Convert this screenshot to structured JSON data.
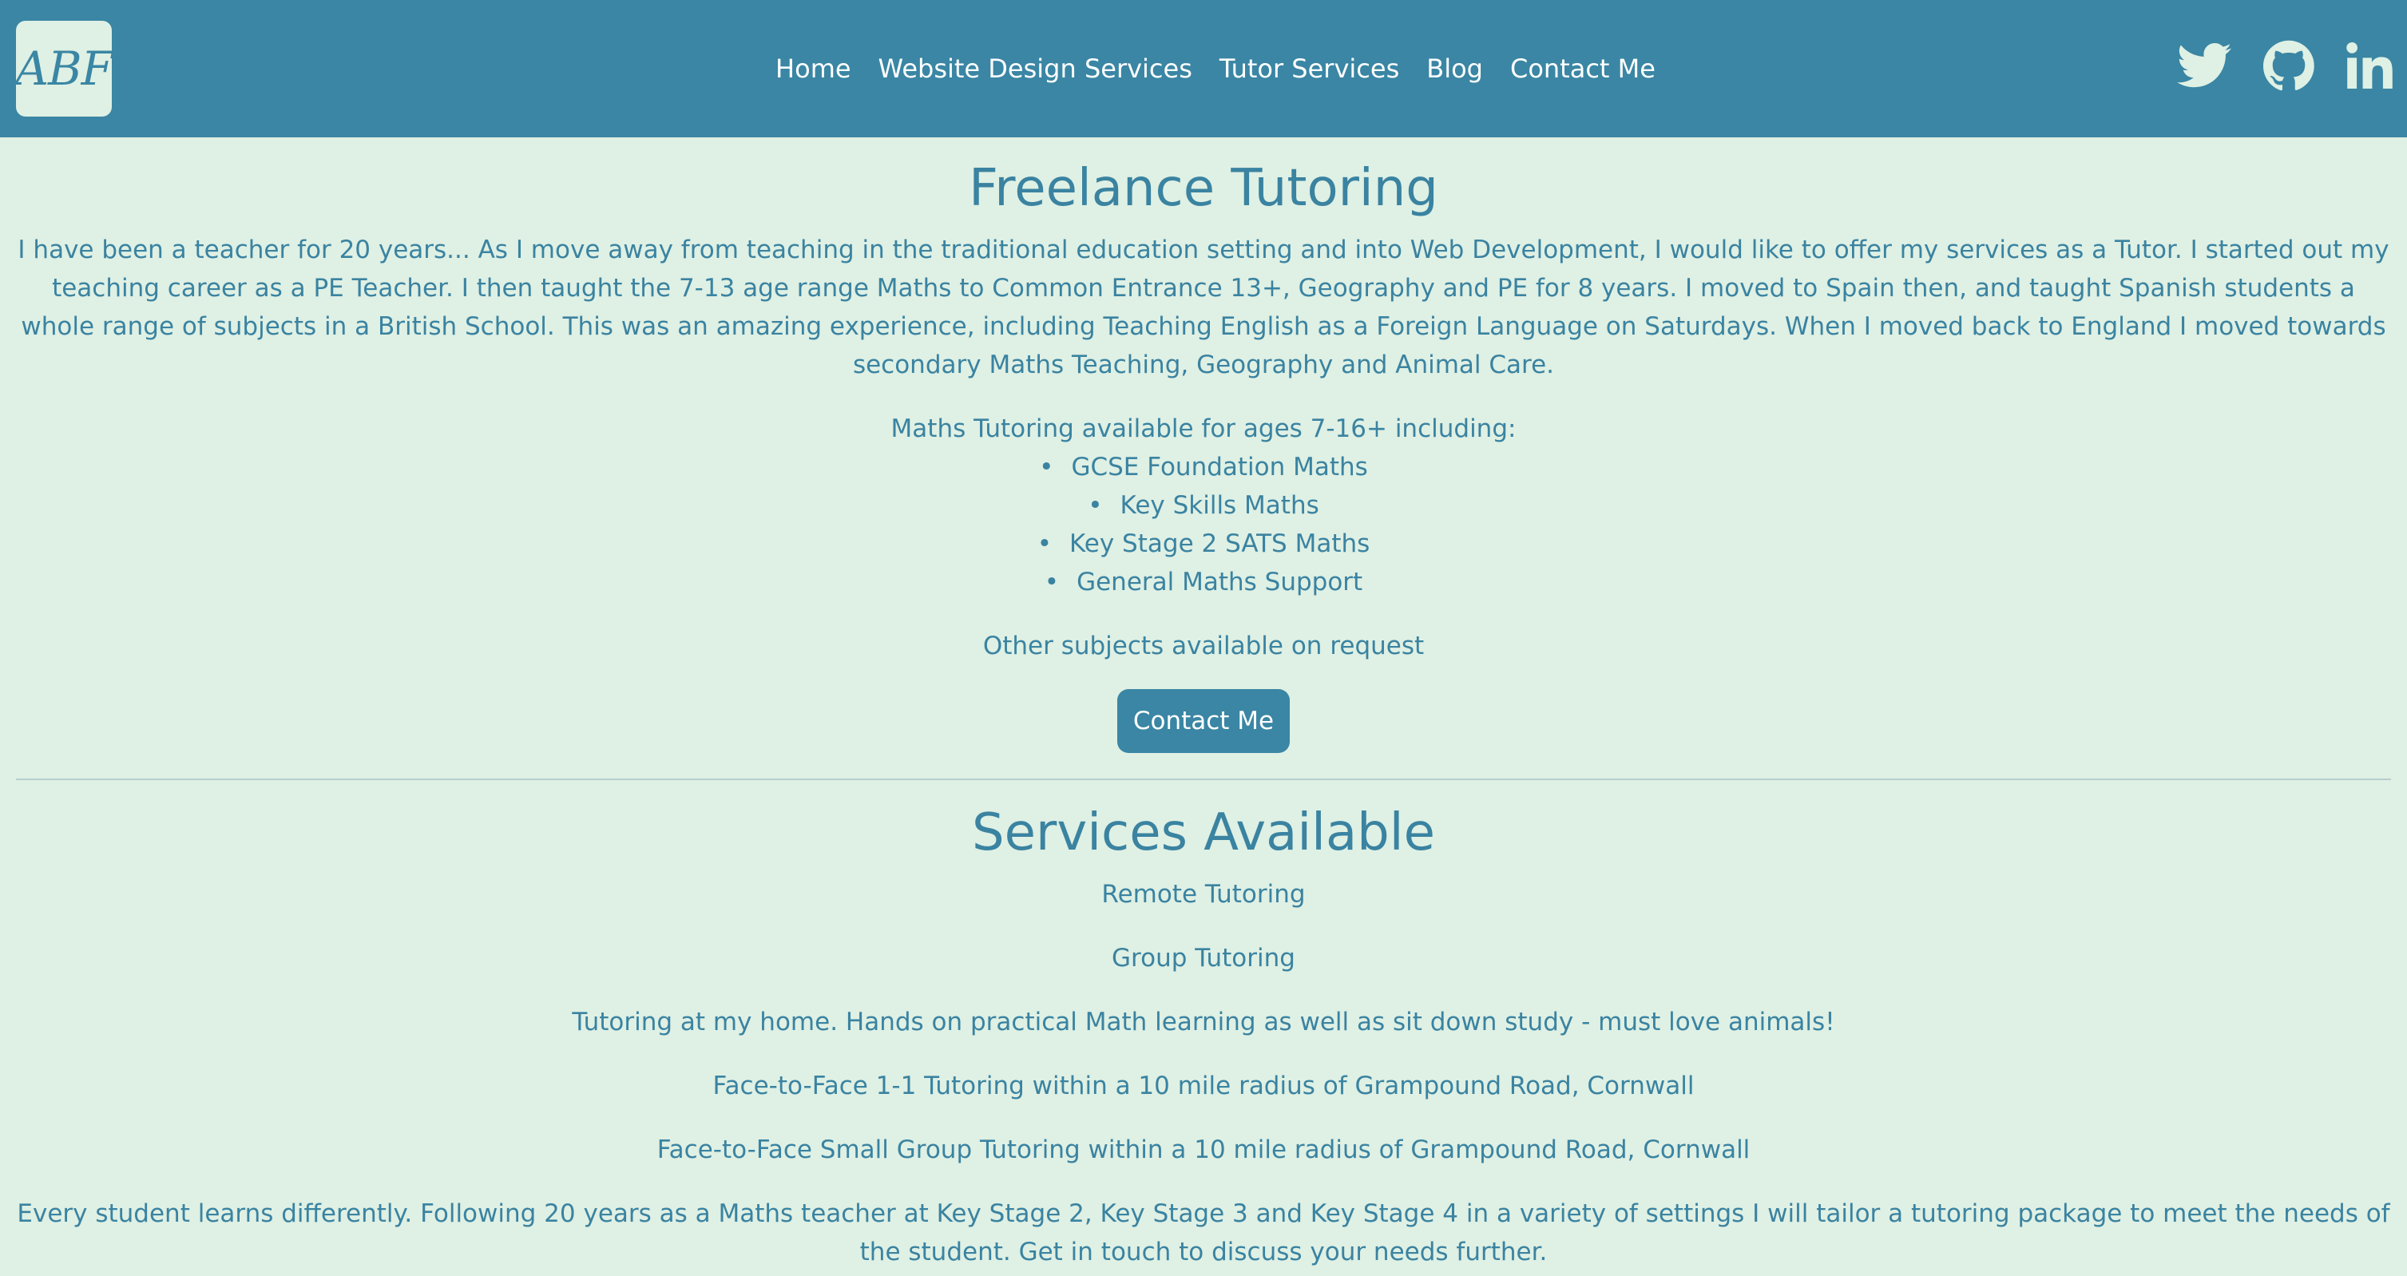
{
  "header": {
    "logo_text": "ABF",
    "nav": [
      {
        "label": "Home"
      },
      {
        "label": "Website Design Services"
      },
      {
        "label": "Tutor Services"
      },
      {
        "label": "Blog"
      },
      {
        "label": "Contact Me"
      }
    ],
    "social_icons": [
      "twitter-icon",
      "github-icon",
      "linkedin-icon"
    ]
  },
  "tutoring": {
    "title": "Freelance Tutoring",
    "intro": "I have been a teacher for 20 years... As I move away from teaching in the traditional education setting and into Web Development, I would like to offer my services as a Tutor. I started out my teaching career as a PE Teacher. I then taught the 7-13 age range Maths to Common Entrance 13+, Geography and PE for 8 years. I moved to Spain then, and taught Spanish students a whole range of subjects in a British School. This was an amazing experience, including Teaching English as a Foreign Language on Saturdays. When I moved back to England I moved towards secondary Maths Teaching, Geography and Animal Care.",
    "maths_heading": "Maths Tutoring available for ages 7-16+ including:",
    "maths_items": [
      "GCSE Foundation Maths",
      "Key Skills Maths",
      "Key Stage 2 SATS Maths",
      "General Maths Support"
    ],
    "other_subjects": "Other subjects available on request",
    "contact_button": "Contact Me"
  },
  "services": {
    "title": "Services Available",
    "items": [
      "Remote Tutoring",
      "Group Tutoring",
      "Tutoring at my home. Hands on practical Math learning as well as sit down study - must love animals!",
      "Face-to-Face 1-1 Tutoring within a 10 mile radius of Grampound Road, Cornwall",
      "Face-to-Face Small Group Tutoring within a 10 mile radius of Grampound Road, Cornwall",
      "Every student learns differently. Following 20 years as a Maths teacher at Key Stage 2, Key Stage 3 and Key Stage 4 in a variety of settings I will tailor a tutoring package to meet the needs of the student. Get in touch to discuss your needs further."
    ]
  },
  "colors": {
    "header_bg": "#3a86a4",
    "page_bg": "#dff0e4",
    "text": "#3a83a1"
  }
}
